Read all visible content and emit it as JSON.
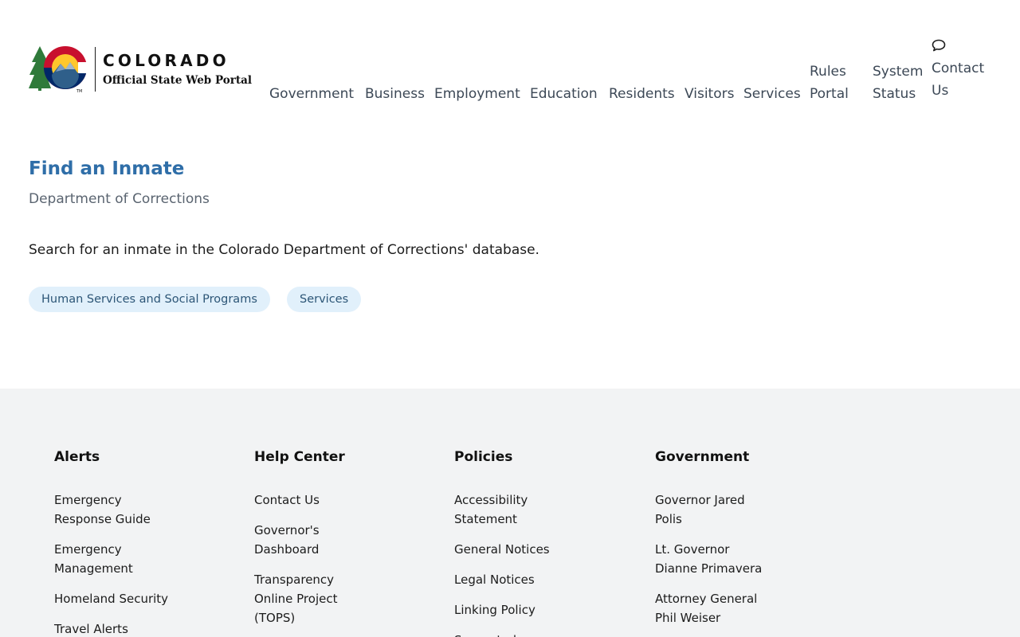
{
  "header": {
    "logo_state": "COLORADO",
    "logo_subtitle": "Official State Web Portal",
    "logo_trademark": "TM",
    "nav": {
      "government": "Government",
      "business": "Business",
      "employment": "Employment",
      "education": "Education",
      "residents": "Residents",
      "visitors": "Visitors",
      "services": "Services",
      "rules_portal_line1": "Rules",
      "rules_portal_line2": "Portal",
      "system_status_line1": "System",
      "system_status_line2": "Status",
      "contact_us_line1": "Contact",
      "contact_us_line2": "Us"
    },
    "icons": {
      "contact": "chat-bubble-icon",
      "logo": "colorado-logo-icon"
    }
  },
  "main": {
    "title": "Find an Inmate",
    "subtitle": "Department of Corrections",
    "description": "Search for an inmate in the Colorado Department of Corrections' database.",
    "tags": [
      "Human Services and Social Programs",
      "Services"
    ]
  },
  "footer": {
    "alerts": {
      "heading": "Alerts",
      "links": [
        "Emergency Response Guide",
        "Emergency Management",
        "Homeland Security",
        "Travel Alerts"
      ]
    },
    "help_center": {
      "heading": "Help Center",
      "links": [
        "Contact Us",
        "Governor's Dashboard",
        "Transparency Online Project (TOPS)"
      ]
    },
    "policies": {
      "heading": "Policies",
      "links": [
        "Accessibility Statement",
        "General Notices",
        "Legal Notices",
        "Linking Policy",
        "Supported"
      ]
    },
    "government": {
      "heading": "Government",
      "links": [
        "Governor Jared Polis",
        "Lt. Governor Dianne Primavera",
        "Attorney General Phil Weiser"
      ]
    }
  },
  "colors": {
    "title_blue": "#2f6ea8",
    "nav_text": "#3c4856",
    "tag_bg": "#e1f0fb",
    "footer_bg": "#f2f3f4",
    "logo_red": "#c8102e",
    "logo_navy": "#002868",
    "logo_gold": "#ffc72c",
    "logo_green": "#2f7a3a"
  }
}
